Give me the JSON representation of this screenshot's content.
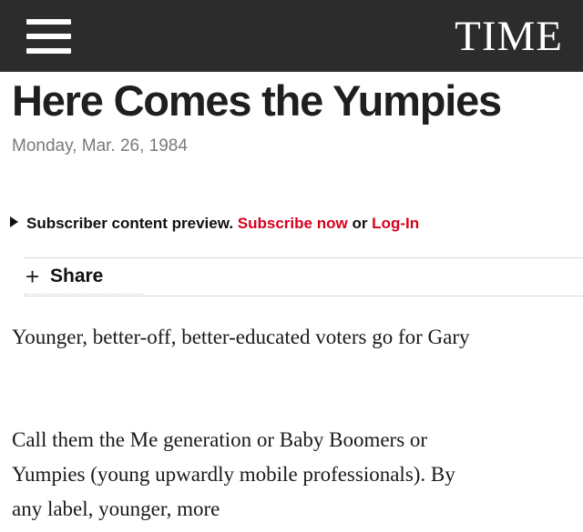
{
  "header": {
    "logo": "TIME",
    "menu_icon": "hamburger-menu-icon"
  },
  "article": {
    "headline": "Here Comes the Yumpies",
    "date": "Monday, Mar. 26, 1984",
    "subscriber_notice": {
      "lead": "Subscriber content preview.",
      "subscribe_link": "Subscribe now",
      "separator": "or",
      "login_link": "Log-In"
    },
    "share": {
      "icon": "+",
      "label": "Share"
    },
    "paragraphs": [
      "Younger, better-off, better-educated voters go for Gary",
      "Call them the Me generation or Baby Boomers or Yumpies (young upwardly mobile professionals). By any label, younger, more"
    ]
  },
  "colors": {
    "header_bg": "#2c2c2c",
    "link_red": "#d8001d",
    "date_gray": "#7a7a7a"
  }
}
